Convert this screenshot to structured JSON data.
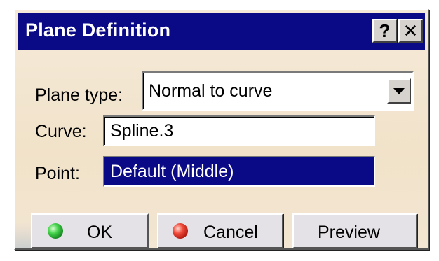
{
  "dialog": {
    "title": "Plane Definition",
    "help_label": "?",
    "close_label": "✕"
  },
  "form": {
    "plane_type": {
      "label": "Plane type:",
      "value": "Normal to curve"
    },
    "curve": {
      "label": "Curve:",
      "value": "Spline.3"
    },
    "point": {
      "label": "Point:",
      "value": "Default (Middle)"
    }
  },
  "buttons": {
    "ok": {
      "label": "OK",
      "icon": "green-led-icon"
    },
    "cancel": {
      "label": "Cancel",
      "icon": "red-led-icon"
    },
    "preview": {
      "label": "Preview"
    }
  },
  "colors": {
    "titlebar": "#0b0a86",
    "dialog_bg": "#f3e6d2",
    "selection": "#0b0a86"
  }
}
